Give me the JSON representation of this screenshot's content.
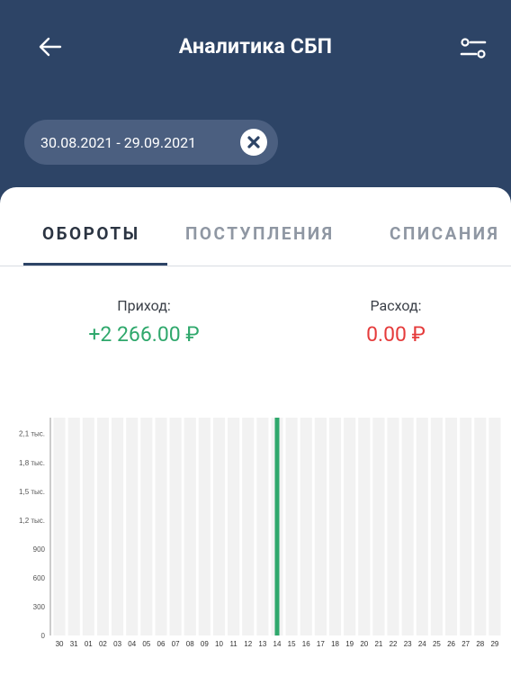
{
  "header": {
    "title": "Аналитика СБП",
    "date_range": "30.08.2021 - 29.09.2021",
    "bg_color": "#2d4466"
  },
  "tabs": [
    {
      "label": "ОБОРОТЫ",
      "active": true
    },
    {
      "label": "ПОСТУПЛЕНИЯ",
      "active": false
    },
    {
      "label": "СПИСАНИЯ",
      "active": false
    }
  ],
  "summary": {
    "income_label": "Приход:",
    "income_value": "+2 266.00 ₽",
    "income_color": "#2fa86c",
    "expense_label": "Расход:",
    "expense_value": "0.00 ₽",
    "expense_color": "#e53b3b"
  },
  "icons": [
    "arrow-left-icon",
    "filter-sliders-icon",
    "close-circle-icon"
  ],
  "chart_data": {
    "type": "bar",
    "categories": [
      "30",
      "31",
      "01",
      "02",
      "03",
      "04",
      "05",
      "06",
      "07",
      "08",
      "09",
      "10",
      "11",
      "12",
      "13",
      "14",
      "15",
      "16",
      "17",
      "18",
      "19",
      "20",
      "21",
      "22",
      "23",
      "24",
      "25",
      "26",
      "27",
      "28",
      "29"
    ],
    "values": [
      0,
      0,
      0,
      0,
      0,
      0,
      0,
      0,
      0,
      0,
      0,
      0,
      0,
      0,
      0,
      2266,
      0,
      0,
      0,
      0,
      0,
      0,
      0,
      0,
      0,
      0,
      0,
      0,
      0,
      0,
      0
    ],
    "yticks": [
      "0",
      "300",
      "600",
      "900",
      "1,2 тыс.",
      "1,5 тыс.",
      "1,8 тыс.",
      "2,1 тыс."
    ],
    "ytick_values": [
      0,
      300,
      600,
      900,
      1200,
      1500,
      1800,
      2100
    ],
    "ylim": [
      0,
      2266
    ],
    "bar_color": "#2fa86c",
    "grid": true
  }
}
